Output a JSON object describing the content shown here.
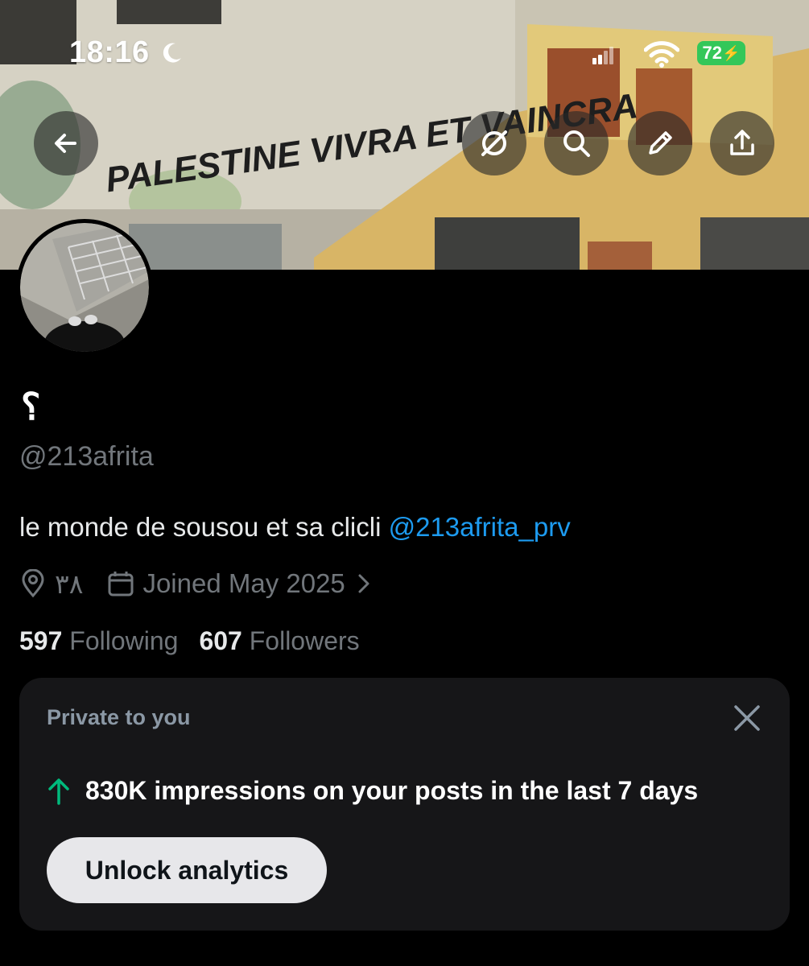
{
  "status_bar": {
    "time": "18:16",
    "battery": "72"
  },
  "banner": {
    "graffiti_text": "PALESTINE VIVRA ET VAINCRA"
  },
  "profile": {
    "display_name": "؟",
    "handle": "@213afrita",
    "bio_text": "le monde de sousou et sa clicli ",
    "bio_mention": "@213afrita_prv",
    "location": "٣٨",
    "joined": "Joined May 2025",
    "following_count": "597",
    "following_label": "Following",
    "followers_count": "607",
    "followers_label": "Followers"
  },
  "analytics_card": {
    "title": "Private to you",
    "impressions_text": "830K impressions on your posts in the last 7 days",
    "button_label": "Unlock analytics"
  },
  "colors": {
    "accent": "#1d9bf0",
    "up_arrow": "#00ba7c",
    "battery": "#34c759"
  },
  "icons": [
    "back-arrow-icon",
    "grok-icon",
    "search-icon",
    "edit-icon",
    "share-icon",
    "location-pin-icon",
    "calendar-icon",
    "chevron-right-icon",
    "close-icon",
    "arrow-up-icon",
    "moon-icon",
    "signal-icon",
    "wifi-icon"
  ]
}
